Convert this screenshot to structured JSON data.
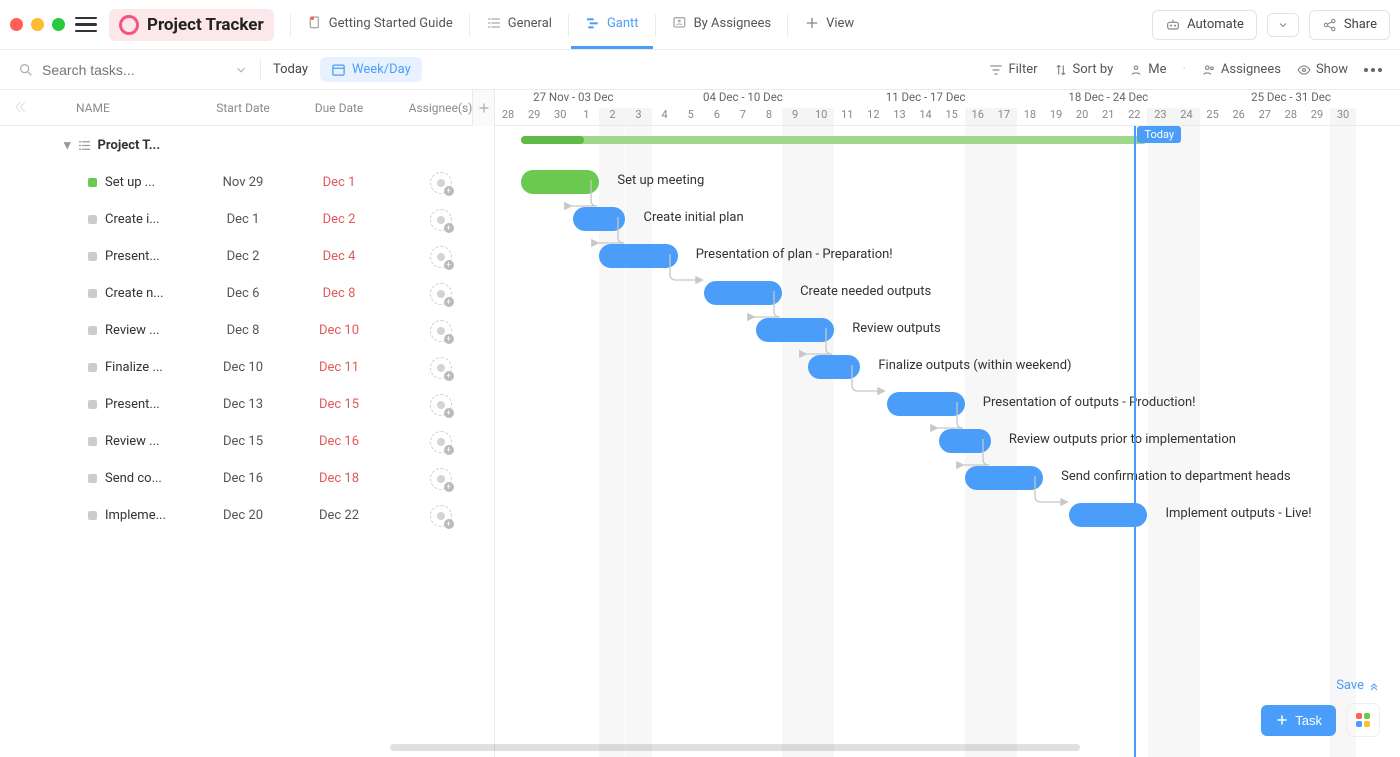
{
  "window": {
    "project_title": "Project Tracker",
    "views": [
      {
        "icon": "doc",
        "label": "Getting Started Guide",
        "active": false
      },
      {
        "icon": "list",
        "label": "General",
        "active": false
      },
      {
        "icon": "gantt",
        "label": "Gantt",
        "active": true
      },
      {
        "icon": "people",
        "label": "By Assignees",
        "active": false
      }
    ],
    "add_view_label": "View",
    "automate_label": "Automate",
    "share_label": "Share"
  },
  "toolbar": {
    "search_placeholder": "Search tasks...",
    "today_label": "Today",
    "weekday_label": "Week/Day",
    "filter": "Filter",
    "sortby": "Sort by",
    "me": "Me",
    "assignees": "Assignees",
    "show": "Show"
  },
  "columns": {
    "name": "NAME",
    "start": "Start Date",
    "due": "Due Date",
    "assignees": "Assignee(s)"
  },
  "group": {
    "name": "Project T..."
  },
  "tasks": [
    {
      "name": "Set up ...",
      "full": "Set up meeting",
      "start": "Nov 29",
      "due": "Dec 1",
      "due_past": true,
      "bullet": "green",
      "bar_start": 1,
      "bar_len": 3,
      "bar_color": "green"
    },
    {
      "name": "Create i...",
      "full": "Create initial plan",
      "start": "Dec 1",
      "due": "Dec 2",
      "due_past": true,
      "bullet": "grey",
      "bar_start": 3,
      "bar_len": 2,
      "bar_color": "blue"
    },
    {
      "name": "Present...",
      "full": "Presentation of plan - Preparation!",
      "start": "Dec 2",
      "due": "Dec 4",
      "due_past": true,
      "bullet": "grey",
      "bar_start": 4,
      "bar_len": 3,
      "bar_color": "blue"
    },
    {
      "name": "Create n...",
      "full": "Create needed outputs",
      "start": "Dec 6",
      "due": "Dec 8",
      "due_past": true,
      "bullet": "grey",
      "bar_start": 8,
      "bar_len": 3,
      "bar_color": "blue"
    },
    {
      "name": "Review ...",
      "full": "Review outputs",
      "start": "Dec 8",
      "due": "Dec 10",
      "due_past": true,
      "bullet": "grey",
      "bar_start": 10,
      "bar_len": 3,
      "bar_color": "blue"
    },
    {
      "name": "Finalize ...",
      "full": "Finalize outputs (within weekend)",
      "start": "Dec 10",
      "due": "Dec 11",
      "due_past": true,
      "bullet": "grey",
      "bar_start": 12,
      "bar_len": 2,
      "bar_color": "blue"
    },
    {
      "name": "Present...",
      "full": "Presentation of outputs - Production!",
      "start": "Dec 13",
      "due": "Dec 15",
      "due_past": true,
      "bullet": "grey",
      "bar_start": 15,
      "bar_len": 3,
      "bar_color": "blue"
    },
    {
      "name": "Review ...",
      "full": "Review outputs prior to implementation",
      "start": "Dec 15",
      "due": "Dec 16",
      "due_past": true,
      "bullet": "grey",
      "bar_start": 17,
      "bar_len": 2,
      "bar_color": "blue"
    },
    {
      "name": "Send co...",
      "full": "Send confirmation to department heads",
      "start": "Dec 16",
      "due": "Dec 18",
      "due_past": true,
      "bullet": "grey",
      "bar_start": 18,
      "bar_len": 3,
      "bar_color": "blue"
    },
    {
      "name": "Impleme...",
      "full": "Implement outputs - Live!",
      "start": "Dec 20",
      "due": "Dec 22",
      "due_past": false,
      "bullet": "grey",
      "bar_start": 22,
      "bar_len": 3,
      "bar_color": "blue"
    }
  ],
  "timeline": {
    "weeks": [
      "27 Nov - 03 Dec",
      "04 Dec - 10 Dec",
      "11 Dec - 17 Dec",
      "18 Dec - 24 Dec",
      "25 Dec - 31 Dec"
    ],
    "days": [
      {
        "n": "28",
        "we": false
      },
      {
        "n": "29",
        "we": false
      },
      {
        "n": "30",
        "we": false
      },
      {
        "n": "1",
        "we": false
      },
      {
        "n": "2",
        "we": true
      },
      {
        "n": "3",
        "we": true
      },
      {
        "n": "4",
        "we": false
      },
      {
        "n": "5",
        "we": false
      },
      {
        "n": "6",
        "we": false
      },
      {
        "n": "7",
        "we": false
      },
      {
        "n": "8",
        "we": false
      },
      {
        "n": "9",
        "we": true
      },
      {
        "n": "10",
        "we": true
      },
      {
        "n": "11",
        "we": false
      },
      {
        "n": "12",
        "we": false
      },
      {
        "n": "13",
        "we": false
      },
      {
        "n": "14",
        "we": false
      },
      {
        "n": "15",
        "we": false
      },
      {
        "n": "16",
        "we": true
      },
      {
        "n": "17",
        "we": true
      },
      {
        "n": "18",
        "we": false
      },
      {
        "n": "19",
        "we": false
      },
      {
        "n": "20",
        "we": false
      },
      {
        "n": "21",
        "we": false
      },
      {
        "n": "22",
        "we": false
      },
      {
        "n": "23",
        "we": true
      },
      {
        "n": "24",
        "we": true
      },
      {
        "n": "25",
        "we": false
      },
      {
        "n": "26",
        "we": false
      },
      {
        "n": "27",
        "we": false
      },
      {
        "n": "28",
        "we": false
      },
      {
        "n": "29",
        "we": false
      },
      {
        "n": "30",
        "we": true
      }
    ],
    "today_index": 24,
    "today_label": "Today",
    "summary": {
      "start": 1,
      "len": 24,
      "progress": 0.1
    }
  },
  "floating": {
    "save": "Save",
    "task_btn": "Task"
  },
  "colors": {
    "accent": "#4a9df8",
    "green": "#6bc950",
    "pink": "#f7567c"
  }
}
